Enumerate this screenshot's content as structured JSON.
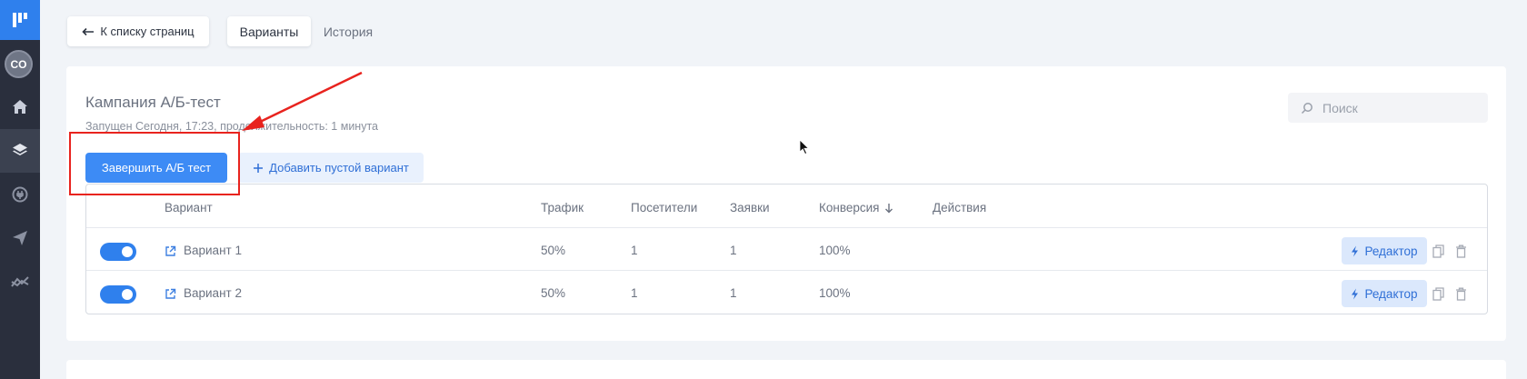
{
  "sidebar": {
    "avatar_initials": "CO",
    "items": [
      {
        "icon": "home-icon"
      },
      {
        "icon": "layers-icon",
        "active": true
      },
      {
        "icon": "plug-icon"
      },
      {
        "icon": "send-icon"
      },
      {
        "icon": "analytics-icon"
      }
    ]
  },
  "topbar": {
    "back_label": "К списку страниц",
    "tabs": [
      {
        "label": "Варианты",
        "active": true
      },
      {
        "label": "История",
        "active": false
      }
    ]
  },
  "campaign": {
    "title": "Кампания А/Б-тест",
    "subtitle": "Запущен Сегодня, 17:23, продолжительность: 1 минута",
    "search_placeholder": "Поиск",
    "finish_label": "Завершить А/Б тест",
    "add_label": "Добавить пустой вариант"
  },
  "table": {
    "headers": {
      "variant": "Вариант",
      "traffic": "Трафик",
      "visitors": "Посетители",
      "leads": "Заявки",
      "conversion": "Конверсия",
      "actions": "Действия"
    },
    "rows": [
      {
        "enabled": true,
        "name": "Вариант 1",
        "traffic": "50%",
        "visitors": "1",
        "leads": "1",
        "conversion": "100%",
        "editor_label": "Редактор"
      },
      {
        "enabled": true,
        "name": "Вариант 2",
        "traffic": "50%",
        "visitors": "1",
        "leads": "1",
        "conversion": "100%",
        "editor_label": "Редактор"
      }
    ]
  },
  "colors": {
    "sidebar_bg": "#2a2f3d",
    "accent": "#2f80ed",
    "annotation_red": "#e8231e"
  }
}
